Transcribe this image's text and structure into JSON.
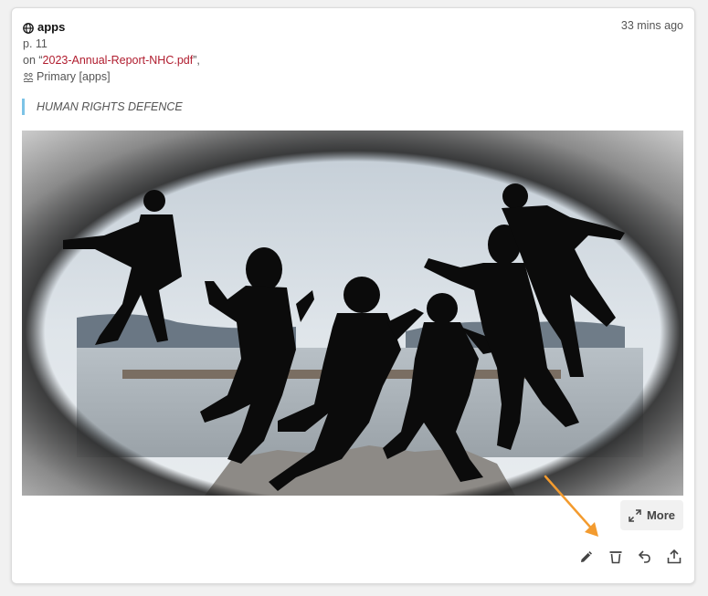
{
  "annotation": {
    "group": "apps",
    "page": "p. 11",
    "on_prefix": "on “",
    "document": "2023-Annual-Report-NHC.pdf",
    "on_suffix": "”,",
    "permission": "Primary [apps]",
    "timestamp": "33 mins ago",
    "quote": "HUMAN RIGHTS DEFENCE"
  },
  "more_button": {
    "label": "More"
  },
  "actions": [
    "edit-icon",
    "delete-icon",
    "reply-icon",
    "share-icon"
  ],
  "colors": {
    "link": "#b01c2e",
    "quote_bar": "#7cc3e6",
    "arrow": "#f39b2f"
  }
}
